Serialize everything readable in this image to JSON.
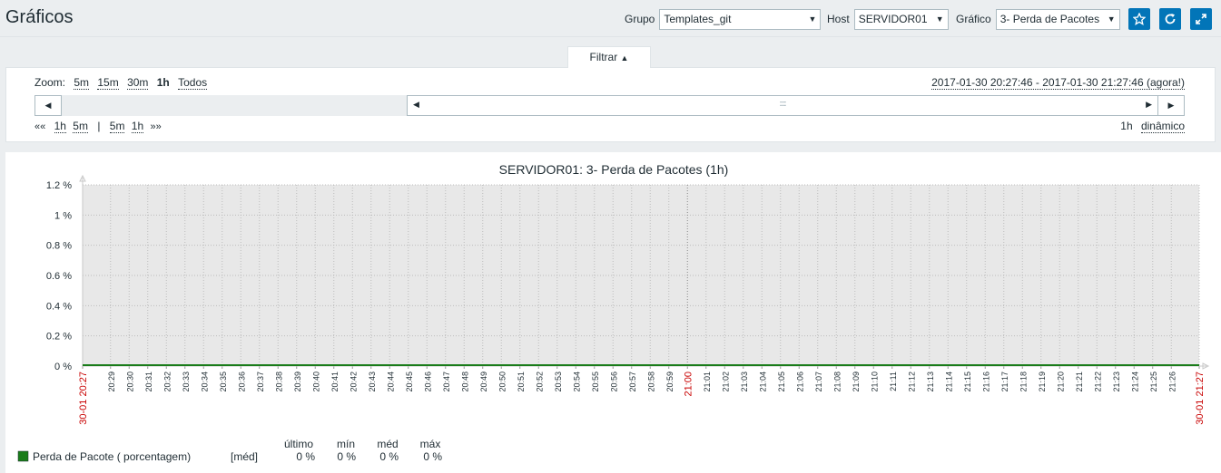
{
  "header": {
    "title": "Gráficos",
    "group_label": "Grupo",
    "group_value": "Templates_git",
    "host_label": "Host",
    "host_value": "SERVIDOR01",
    "graph_label": "Gráfico",
    "graph_value": "3- Perda de Pacotes"
  },
  "filter": {
    "tab_label": "Filtrar",
    "zoom_label": "Zoom:",
    "zoom_options": [
      "5m",
      "15m",
      "30m",
      "1h",
      "Todos"
    ],
    "period_range": "2017-01-30 20:27:46 - 2017-01-30 21:27:46 (agora!)",
    "nav_back_arrow": "««",
    "nav_back": [
      "1h",
      "5m"
    ],
    "nav_separator": "|",
    "nav_forward": [
      "5m",
      "1h"
    ],
    "nav_forward_arrow": "»»",
    "period_value": "1h",
    "dynamic_label": "dinâmico",
    "grip": ":::"
  },
  "chart_data": {
    "type": "line",
    "title": "SERVIDOR01: 3- Perda de Pacotes (1h)",
    "y_ticks": [
      "1.2 %",
      "1 %",
      "0.8 %",
      "0.6 %",
      "0.4 %",
      "0.2 %",
      "0 %"
    ],
    "ylim": [
      0,
      1.2
    ],
    "x_start_label": "30-01 20:27",
    "x_end_label": "30-01 21:27",
    "x_ticks": [
      "20:29",
      "20:30",
      "20:31",
      "20:32",
      "20:33",
      "20:34",
      "20:35",
      "20:36",
      "20:37",
      "20:38",
      "20:39",
      "20:40",
      "20:41",
      "20:42",
      "20:43",
      "20:44",
      "20:45",
      "20:46",
      "20:47",
      "20:48",
      "20:49",
      "20:50",
      "20:51",
      "20:52",
      "20:53",
      "20:54",
      "20:55",
      "20:56",
      "20:57",
      "20:58",
      "20:59",
      "21:00",
      "21:01",
      "21:02",
      "21:03",
      "21:04",
      "21:05",
      "21:06",
      "21:07",
      "21:08",
      "21:09",
      "21:10",
      "21:11",
      "21:12",
      "21:13",
      "21:14",
      "21:15",
      "21:16",
      "21:17",
      "21:18",
      "21:19",
      "21:20",
      "21:21",
      "21:22",
      "21:23",
      "21:24",
      "21:25",
      "21:26"
    ],
    "highlight_tick": "21:00",
    "series": [
      {
        "name": "Perda de Pacote ( porcentagem)",
        "values": [
          0,
          0
        ],
        "color": "#1a7c1a"
      }
    ],
    "legend": {
      "headers": [
        "último",
        "mín",
        "méd",
        "máx"
      ],
      "func": "[méd]",
      "last": "0 %",
      "min": "0 %",
      "avg": "0 %",
      "max": "0 %"
    },
    "colors": {
      "plot_bg": "#e8e8e8",
      "grid": "#bcbcbc",
      "axis": "#c8c8c8",
      "red_label": "#c80000"
    }
  }
}
